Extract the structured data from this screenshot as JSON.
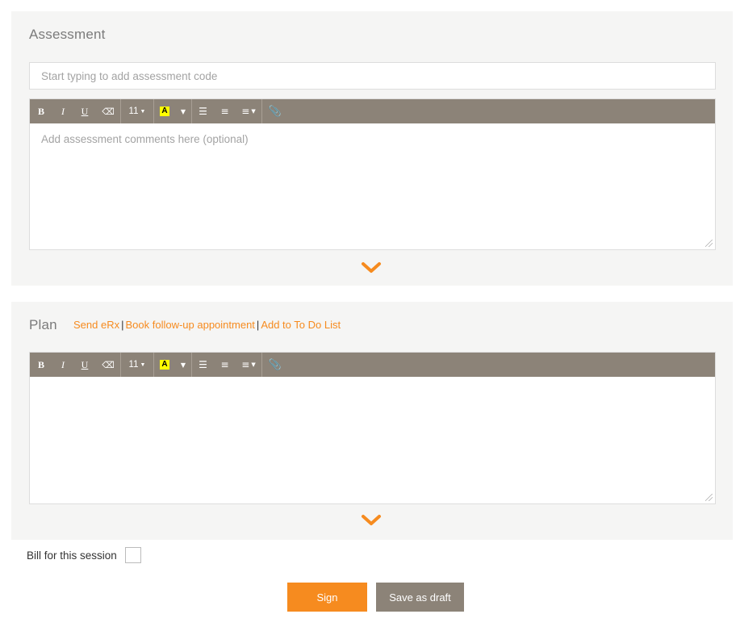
{
  "assessment": {
    "title": "Assessment",
    "code_placeholder": "Start typing to add assessment code",
    "comments_placeholder": "Add assessment comments here (optional)"
  },
  "plan": {
    "title": "Plan",
    "links": {
      "send_erx": "Send eRx",
      "book_followup": "Book follow-up appointment",
      "add_todo": "Add to To Do List",
      "separator": "|"
    },
    "comments_value": ""
  },
  "toolbar": {
    "bold": "B",
    "italic": "I",
    "underline": "U",
    "eraser_icon": "eraser-icon",
    "font_size": "11",
    "highlight_letter": "A",
    "unordered_list_icon": "unordered-list-icon",
    "ordered_list_icon": "ordered-list-icon",
    "align_icon": "align-left-icon",
    "attach_icon": "paperclip-icon"
  },
  "billing": {
    "label": "Bill for this session",
    "checked": false
  },
  "actions": {
    "sign_label": "Sign",
    "draft_label": "Save as draft"
  },
  "colors": {
    "accent": "#f68b1f",
    "toolbar": "#8c8378",
    "panel_bg": "#f5f5f4",
    "highlight": "#ffff00"
  }
}
